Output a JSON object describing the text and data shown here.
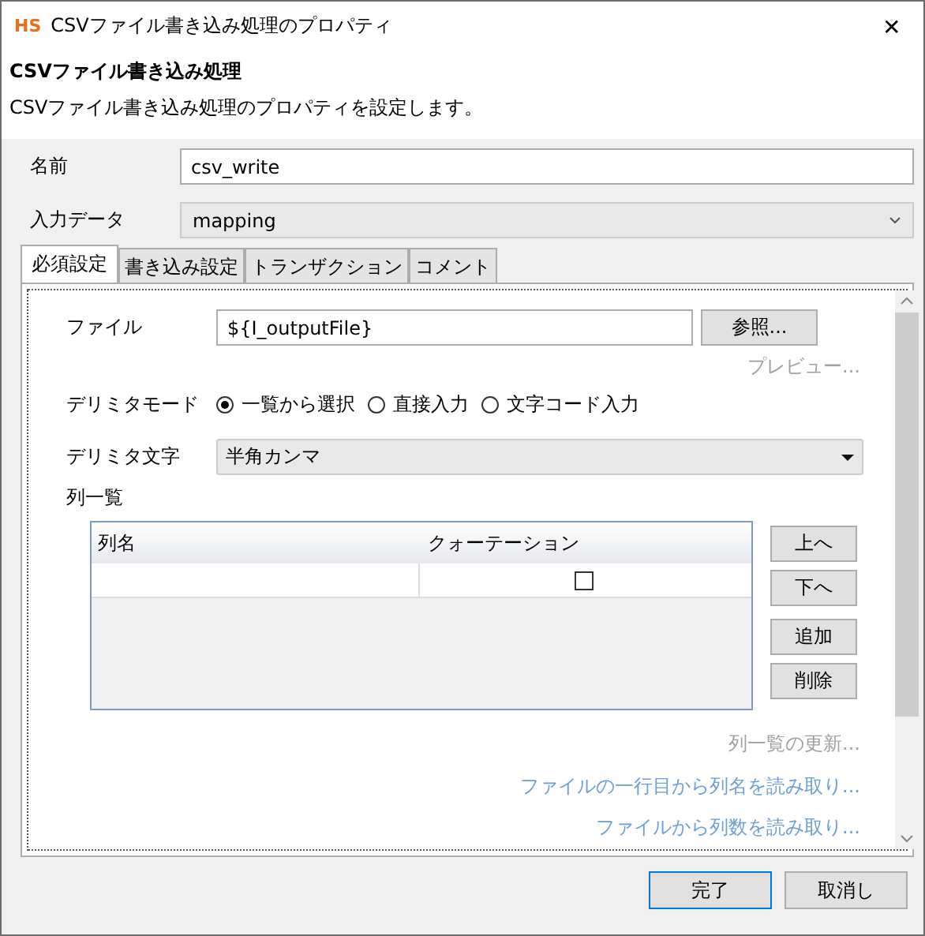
{
  "window": {
    "logo": "HS",
    "title": "CSVファイル書き込み処理のプロパティ",
    "close": "✕"
  },
  "header": {
    "title": "CSVファイル書き込み処理",
    "description": "CSVファイル書き込み処理のプロパティを設定します。"
  },
  "name_field": {
    "label": "名前",
    "value": "csv_write"
  },
  "input_data": {
    "label": "入力データ",
    "value": "mapping",
    "disabled": true
  },
  "tabs": [
    {
      "label": "必須設定",
      "selected": true
    },
    {
      "label": "書き込み設定",
      "selected": false
    },
    {
      "label": "トランザクション",
      "selected": false
    },
    {
      "label": "コメント",
      "selected": false
    }
  ],
  "file": {
    "label": "ファイル",
    "value": "${I_outputFile}",
    "browse_button": "参照..."
  },
  "preview_link": {
    "label": "プレビュー...",
    "disabled": true
  },
  "delimiter_mode": {
    "label": "デリミタモード",
    "options": [
      {
        "label": "一覧から選択",
        "selected": true
      },
      {
        "label": "直接入力",
        "selected": false
      },
      {
        "label": "文字コード入力",
        "selected": false
      }
    ]
  },
  "delimiter_char": {
    "label": "デリミタ文字",
    "value": "半角カンマ"
  },
  "column_list": {
    "label": "列一覧",
    "columns": [
      "列名",
      "クォーテーション"
    ],
    "rows": [
      {
        "name": "",
        "quoted": false
      }
    ],
    "buttons": [
      "上へ",
      "下へ",
      "追加",
      "削除"
    ]
  },
  "links": [
    {
      "label": "列一覧の更新...",
      "disabled": true
    },
    {
      "label": "ファイルの一行目から列名を読み取り...",
      "disabled": false
    },
    {
      "label": "ファイルから列数を読み取り...",
      "disabled": false
    }
  ],
  "footer_buttons": [
    {
      "label": "完了",
      "default": true
    },
    {
      "label": "取消し",
      "default": false
    }
  ]
}
